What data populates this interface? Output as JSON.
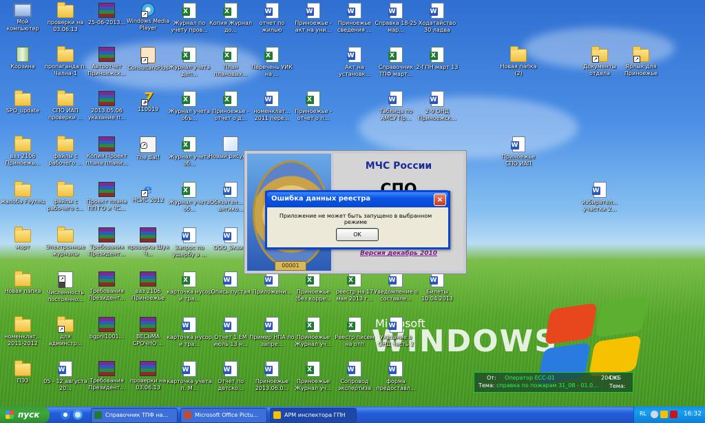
{
  "desktop": {
    "icons": [
      {
        "label": "Мой компьютер",
        "type": "pc",
        "shortcut": false
      },
      {
        "label": "проверки на 03.06.13",
        "type": "folder",
        "shortcut": false
      },
      {
        "label": "25-06-2013...",
        "type": "rar",
        "shortcut": false
      },
      {
        "label": "Windows Media Player",
        "type": "media",
        "shortcut": true
      },
      {
        "label": "Журнал по учету пров...",
        "type": "excel",
        "shortcut": false
      },
      {
        "label": "Копия Журнал до...",
        "type": "excel",
        "shortcut": false
      },
      {
        "label": "отчет по жилью",
        "type": "word",
        "shortcut": false
      },
      {
        "label": "Приноежье - акт на уни...",
        "type": "word",
        "shortcut": false
      },
      {
        "label": "Приноежье сведения ...",
        "type": "word",
        "shortcut": false
      },
      {
        "label": "Справка 18-25 мар...",
        "type": "word",
        "shortcut": false
      },
      {
        "label": "Ходатайство 30 ладва",
        "type": "word",
        "shortcut": false
      },
      {
        "label": "Корзина",
        "type": "bin",
        "shortcut": false
      },
      {
        "label": "пропаганда п. Чална-1",
        "type": "folder",
        "shortcut": false
      },
      {
        "label": "Автоотчет Приноежск...",
        "type": "rar",
        "shortcut": false
      },
      {
        "label": "ConsultantPlus",
        "type": "consult",
        "shortcut": true
      },
      {
        "label": "Журнал учета деп...",
        "type": "excel",
        "shortcut": false
      },
      {
        "label": "План плановых...",
        "type": "excel",
        "shortcut": false
      },
      {
        "label": "Перечень УИК на ...",
        "type": "excel",
        "shortcut": false
      },
      {
        "label": "Акт на установк...",
        "type": "word",
        "shortcut": false
      },
      {
        "label": "Справочник ТПФ март...",
        "type": "excel",
        "shortcut": false
      },
      {
        "label": "2-ГПН март 13",
        "type": "excel",
        "shortcut": false
      },
      {
        "label": "SPO_update",
        "type": "folder",
        "shortcut": false
      },
      {
        "label": "СПО ИАП проверки ...",
        "type": "folder",
        "shortcut": false
      },
      {
        "label": "2013.05.06 указание п...",
        "type": "rar",
        "shortcut": false
      },
      {
        "label": "110019",
        "type": "seven",
        "shortcut": true
      },
      {
        "label": "Журнал учета объ...",
        "type": "excel",
        "shortcut": false
      },
      {
        "label": "Приноежье - отчет о д...",
        "type": "excel",
        "shortcut": false
      },
      {
        "label": "номенклат... 2011 пере...",
        "type": "word",
        "shortcut": false
      },
      {
        "label": "Приноежье - отчет о п...",
        "type": "excel",
        "shortcut": false
      },
      {
        "label": "Таблица по АМСУ Пр...",
        "type": "word",
        "shortcut": false
      },
      {
        "label": "2-9 ОНД Приноежск...",
        "type": "word",
        "shortcut": false
      },
      {
        "label": "ваз 2106 Приноежь...",
        "type": "folder",
        "shortcut": false
      },
      {
        "label": "файлы с рабочего ...",
        "type": "folder",
        "shortcut": false
      },
      {
        "label": "Копия Проект плана плани...",
        "type": "rar",
        "shortcut": false
      },
      {
        "label": "The Bat!",
        "type": "bat",
        "shortcut": true
      },
      {
        "label": "Журнал учета об...",
        "type": "excel",
        "shortcut": false
      },
      {
        "label": "Новый рисунок",
        "type": "bmp",
        "shortcut": false
      },
      {
        "label": "жалоба Реулец",
        "type": "folder",
        "shortcut": false
      },
      {
        "label": "файлы с рабочего с...",
        "type": "folder",
        "shortcut": false
      },
      {
        "label": "Проект плана ПП ГО и ЧС...",
        "type": "rar",
        "shortcut": false
      },
      {
        "label": "НСИС 2012",
        "type": "ie",
        "shortcut": true
      },
      {
        "label": "Журнал учета об...",
        "type": "excel",
        "shortcut": false
      },
      {
        "label": "Обязател... по антико...",
        "type": "word",
        "shortcut": false
      },
      {
        "label": "март",
        "type": "folder",
        "shortcut": false
      },
      {
        "label": "Электронные журналы",
        "type": "folder",
        "shortcut": false
      },
      {
        "label": "Требования Президент...",
        "type": "rar",
        "shortcut": false
      },
      {
        "label": "проверка Шуя Ч...",
        "type": "rar",
        "shortcut": false
      },
      {
        "label": "Запрос по ущербу в ...",
        "type": "word",
        "shortcut": false
      },
      {
        "label": "ООО_Экзи...",
        "type": "word",
        "shortcut": false
      },
      {
        "label": "Новая папка",
        "type": "folder",
        "shortcut": false
      },
      {
        "label": "Численность постоянно...",
        "type": "script",
        "shortcut": true
      },
      {
        "label": "Требования Президент...",
        "type": "rar",
        "shortcut": false
      },
      {
        "label": "ваз 2106 Приноежье",
        "type": "rar",
        "shortcut": false
      },
      {
        "label": "карточка нусор и тра...",
        "type": "excel",
        "shortcut": false
      },
      {
        "label": "Опись пустая",
        "type": "word",
        "shortcut": false
      },
      {
        "label": "Приложени...",
        "type": "word",
        "shortcut": false
      },
      {
        "label": "Приноежье (без корре...",
        "type": "excel",
        "shortcut": false
      },
      {
        "label": "реестр на 17 мая 2013 г...",
        "type": "excel",
        "shortcut": false
      },
      {
        "label": "Уведомление о составле...",
        "type": "word",
        "shortcut": false
      },
      {
        "label": "Билеты 10.04.2013",
        "type": "word",
        "shortcut": false
      },
      {
        "label": "номенклат... 2011-2012",
        "type": "folder",
        "shortcut": false
      },
      {
        "label": "для админстр...",
        "type": "folder",
        "shortcut": true
      },
      {
        "label": "bgpnl1001...",
        "type": "rar",
        "shortcut": false
      },
      {
        "label": "ВЕСЬМА СРОЧНО ...",
        "type": "rar",
        "shortcut": false
      },
      {
        "label": "карточка нусор и тра...",
        "type": "word",
        "shortcut": false
      },
      {
        "label": "Отчет 1 ЕМ июль 13 н...",
        "type": "word",
        "shortcut": false
      },
      {
        "label": "Пример НПА по запре...",
        "type": "word",
        "shortcut": false
      },
      {
        "label": "Приноежье Журнал уч...",
        "type": "excel",
        "shortcut": false
      },
      {
        "label": "Реестр писем на отп",
        "type": "excel",
        "shortcut": false
      },
      {
        "label": "Указание в ОНД часть 2",
        "type": "word",
        "shortcut": false
      },
      {
        "label": "ПЭЗ",
        "type": "folder",
        "shortcut": false
      },
      {
        "label": "05 - 12 августа 20...",
        "type": "word",
        "shortcut": false
      },
      {
        "label": "Требования Президент...",
        "type": "rar",
        "shortcut": false
      },
      {
        "label": "проверки на 03.06.13",
        "type": "rar",
        "shortcut": false
      },
      {
        "label": "карточка учета п. М...",
        "type": "word",
        "shortcut": false
      },
      {
        "label": "Отчет по детско...",
        "type": "word",
        "shortcut": false
      },
      {
        "label": "Приноежье 2013.06.0...",
        "type": "word",
        "shortcut": false
      },
      {
        "label": "Приноежье Журнал уч...",
        "type": "excel",
        "shortcut": false
      },
      {
        "label": "Сопровод экспертиза",
        "type": "word",
        "shortcut": false
      },
      {
        "label": "форма предоставл...",
        "type": "word",
        "shortcut": false
      },
      {
        "label": "Новая папка (2)",
        "type": "folder",
        "shortcut": false
      },
      {
        "label": "Приноежье СПО ИАП",
        "type": "word",
        "shortcut": false
      },
      {
        "label": "Документы отдела",
        "type": "folder",
        "shortcut": true
      },
      {
        "label": "Ярлык для Приноежье",
        "type": "folder",
        "shortcut": true
      },
      {
        "label": "избирател... участки 2...",
        "type": "word",
        "shortcut": false
      }
    ],
    "logo_small": "Microsoft",
    "logo_big": "WINDOWS"
  },
  "splash": {
    "title": "МЧС России",
    "big": "СПО",
    "version": "Версия декабрь 2010",
    "emblem_number": "00001"
  },
  "dialog": {
    "title": "Ошибка данных реестра",
    "message": "Приложение не может быть запущено в выбранном режиме",
    "ok": "OK",
    "close": "×"
  },
  "notification": {
    "from_label": "От:",
    "from_value": "Оператор ЕСС-01",
    "size": "204 КБ",
    "subject_label": "Тема:",
    "subject_value": "справка по пожарам 31_08 - 01.0...",
    "from_label2": "От:",
    "subject_label2": "Тема:"
  },
  "taskbar": {
    "start": "пуск",
    "tasks": [
      {
        "label": "Справочник ТПФ на...",
        "color": "#3c6fd9"
      },
      {
        "label": "Microsoft Office Pictu...",
        "color": "#3c6fd9"
      },
      {
        "label": "АРМ инспектора ГПН",
        "color": "#1d47a8"
      }
    ],
    "lang": "RL",
    "clock": "16:32"
  },
  "colors": {
    "accent": "#0a54e3",
    "taskbar": "#245edb",
    "tray": "#0f8ee9",
    "notify_text": "#2ef05a"
  }
}
